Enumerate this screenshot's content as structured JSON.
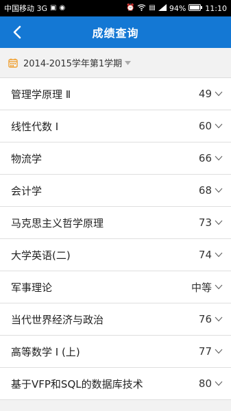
{
  "status_bar": {
    "carrier": "中国移动 3G",
    "battery": "94%",
    "time": "11:10"
  },
  "header": {
    "title": "成绩查询"
  },
  "semester": {
    "label": "2014-2015学年第1学期"
  },
  "courses": [
    {
      "name": "管理学原理 Ⅱ",
      "score": "49"
    },
    {
      "name": "线性代数 Ⅰ",
      "score": "60"
    },
    {
      "name": "物流学",
      "score": "66"
    },
    {
      "name": "会计学",
      "score": "68"
    },
    {
      "name": "马克思主义哲学原理",
      "score": "73"
    },
    {
      "name": "大学英语(二)",
      "score": "74"
    },
    {
      "name": "军事理论",
      "score": "中等"
    },
    {
      "name": "当代世界经济与政治",
      "score": "76"
    },
    {
      "name": "高等数学 Ⅰ (上)",
      "score": "77"
    },
    {
      "name": "基于VFP和SQL的数据库技术",
      "score": "80"
    }
  ]
}
